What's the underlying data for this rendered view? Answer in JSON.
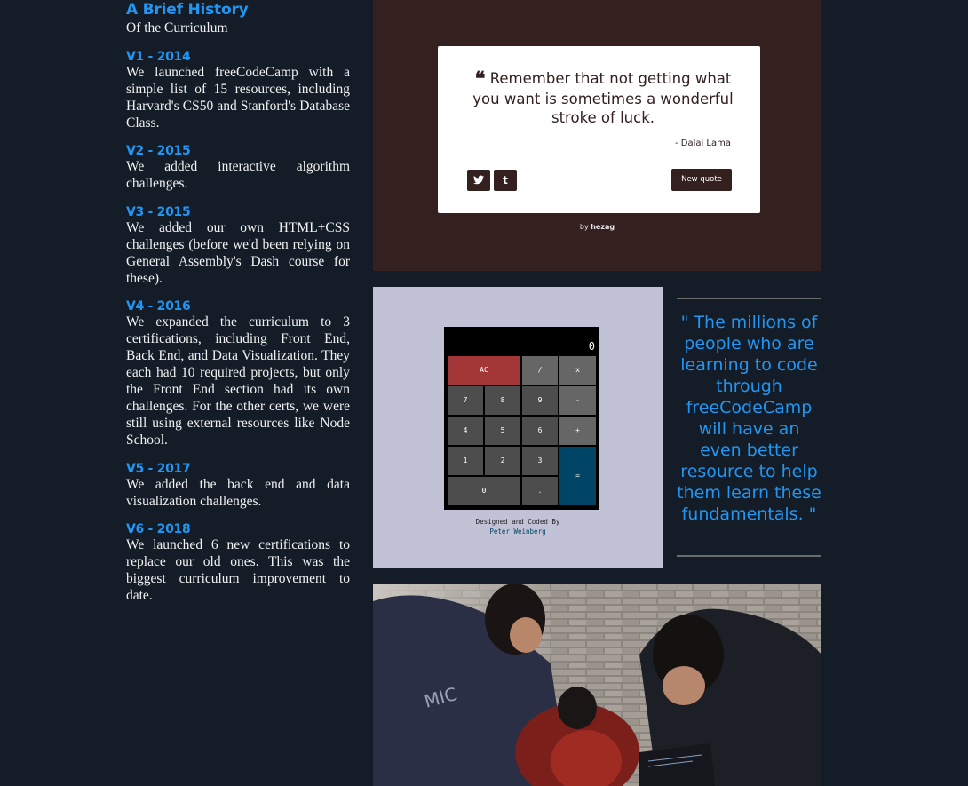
{
  "history": {
    "title": "A Brief History",
    "subtitle": "Of the Curriculum",
    "versions": [
      {
        "label": "V1 - 2014",
        "text": "We launched freeCodeCamp with a simple list of 15 resources, including Harvard's CS50 and Stanford's Database Class."
      },
      {
        "label": "V2 - 2015",
        "text": "We added interactive algorithm challenges."
      },
      {
        "label": "V3 - 2015",
        "text": "We added our own HTML+CSS challenges (before we'd been relying on General Assembly's Dash course for these)."
      },
      {
        "label": "V4 - 2016",
        "text": "We expanded the curriculum to 3 certifications, including Front End, Back End, and Data Visualization. They each had 10 required projects, but only the Front End section had its own challenges. For the other certs, we were still using external resources like Node School."
      },
      {
        "label": "V5 - 2017",
        "text": "We added the back end and data visualization challenges."
      },
      {
        "label": "V6 - 2018",
        "text": "We launched 6 new certifications to replace our old ones. This was the biggest curriculum improvement to date."
      }
    ]
  },
  "quote_machine": {
    "quote": "Remember that not getting what you want is sometimes a wonderful stroke of luck.",
    "author": "- Dalai Lama",
    "twitter_icon": "twitter-icon",
    "tumblr_icon": "tumblr-icon",
    "new_quote_label": "New quote",
    "credit_prefix": "by",
    "credit_name": "hezag",
    "colors": {
      "background": "#33201f",
      "card": "#ffffff"
    }
  },
  "calculator": {
    "display": "0",
    "keys": {
      "ac": "AC",
      "divide": "/",
      "multiply": "x",
      "k7": "7",
      "k8": "8",
      "k9": "9",
      "minus": "-",
      "k4": "4",
      "k5": "5",
      "k6": "6",
      "plus": "+",
      "k1": "1",
      "k2": "2",
      "k3": "3",
      "equals": "=",
      "k0": "0",
      "dot": "."
    },
    "credit_line": "Designed and Coded By",
    "credit_author": "Peter Weinberg",
    "colors": {
      "ac": "#a33636",
      "equals": "#004466",
      "background": "#c2c2d6"
    }
  },
  "quote": {
    "text": "\" The millions of people who are learning to code through freeCodeCamp will have an even better resource to help them learn these fundamentals. \"",
    "color": "#2196f3"
  },
  "photo": {
    "alt": "students-coding-photo"
  }
}
